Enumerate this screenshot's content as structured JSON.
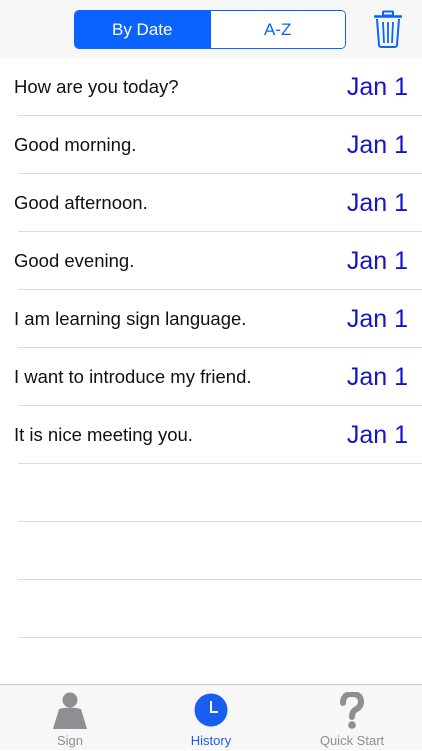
{
  "header": {
    "segments": [
      "By Date",
      "A-Z"
    ],
    "active_segment": "By Date"
  },
  "history": [
    {
      "text": "How are you today?",
      "date": "Jan 1"
    },
    {
      "text": "Good morning.",
      "date": "Jan 1"
    },
    {
      "text": "Good afternoon.",
      "date": "Jan 1"
    },
    {
      "text": "Good evening.",
      "date": "Jan 1"
    },
    {
      "text": "I am learning sign language.",
      "date": "Jan 1"
    },
    {
      "text": "I want to introduce my friend.",
      "date": "Jan 1"
    },
    {
      "text": "It is nice meeting you.",
      "date": "Jan 1"
    }
  ],
  "tabbar": {
    "tabs": [
      {
        "label": "Sign",
        "icon": "person-icon"
      },
      {
        "label": "History",
        "icon": "clock-icon"
      },
      {
        "label": "Quick Start",
        "icon": "question-icon"
      }
    ],
    "active_tab": "History"
  },
  "colors": {
    "accent": "#0a63ff",
    "date_text": "#1414cc",
    "tab_active": "#1a5ef0",
    "tab_inactive": "#8e8e93"
  }
}
